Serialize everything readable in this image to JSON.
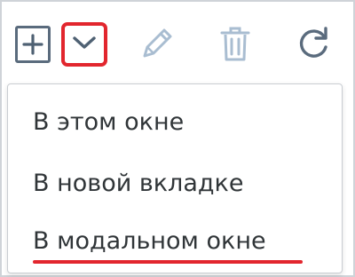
{
  "toolbar": {
    "add_icon": "plus-square-icon",
    "dropdown_icon": "chevron-down-icon",
    "edit_icon": "pencil-icon",
    "delete_icon": "trash-icon",
    "refresh_icon": "refresh-icon",
    "dropdown_highlight_color": "#e2262e"
  },
  "menu": {
    "items": [
      {
        "label": "В этом окне"
      },
      {
        "label": "В новой вкладке"
      },
      {
        "label": "В модальном окне"
      }
    ],
    "highlight_color": "#e2262e"
  }
}
